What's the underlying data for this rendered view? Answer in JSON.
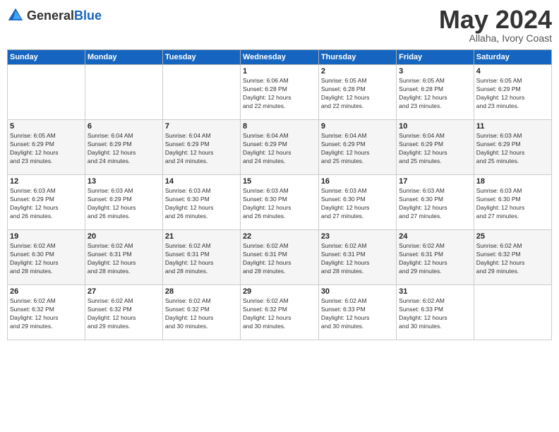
{
  "logo": {
    "general": "General",
    "blue": "Blue"
  },
  "header": {
    "month": "May 2024",
    "location": "Allaha, Ivory Coast"
  },
  "weekdays": [
    "Sunday",
    "Monday",
    "Tuesday",
    "Wednesday",
    "Thursday",
    "Friday",
    "Saturday"
  ],
  "weeks": [
    [
      {
        "day": "",
        "info": ""
      },
      {
        "day": "",
        "info": ""
      },
      {
        "day": "",
        "info": ""
      },
      {
        "day": "1",
        "info": "Sunrise: 6:06 AM\nSunset: 6:28 PM\nDaylight: 12 hours\nand 22 minutes."
      },
      {
        "day": "2",
        "info": "Sunrise: 6:05 AM\nSunset: 6:28 PM\nDaylight: 12 hours\nand 22 minutes."
      },
      {
        "day": "3",
        "info": "Sunrise: 6:05 AM\nSunset: 6:28 PM\nDaylight: 12 hours\nand 23 minutes."
      },
      {
        "day": "4",
        "info": "Sunrise: 6:05 AM\nSunset: 6:29 PM\nDaylight: 12 hours\nand 23 minutes."
      }
    ],
    [
      {
        "day": "5",
        "info": "Sunrise: 6:05 AM\nSunset: 6:29 PM\nDaylight: 12 hours\nand 23 minutes."
      },
      {
        "day": "6",
        "info": "Sunrise: 6:04 AM\nSunset: 6:29 PM\nDaylight: 12 hours\nand 24 minutes."
      },
      {
        "day": "7",
        "info": "Sunrise: 6:04 AM\nSunset: 6:29 PM\nDaylight: 12 hours\nand 24 minutes."
      },
      {
        "day": "8",
        "info": "Sunrise: 6:04 AM\nSunset: 6:29 PM\nDaylight: 12 hours\nand 24 minutes."
      },
      {
        "day": "9",
        "info": "Sunrise: 6:04 AM\nSunset: 6:29 PM\nDaylight: 12 hours\nand 25 minutes."
      },
      {
        "day": "10",
        "info": "Sunrise: 6:04 AM\nSunset: 6:29 PM\nDaylight: 12 hours\nand 25 minutes."
      },
      {
        "day": "11",
        "info": "Sunrise: 6:03 AM\nSunset: 6:29 PM\nDaylight: 12 hours\nand 25 minutes."
      }
    ],
    [
      {
        "day": "12",
        "info": "Sunrise: 6:03 AM\nSunset: 6:29 PM\nDaylight: 12 hours\nand 26 minutes."
      },
      {
        "day": "13",
        "info": "Sunrise: 6:03 AM\nSunset: 6:29 PM\nDaylight: 12 hours\nand 26 minutes."
      },
      {
        "day": "14",
        "info": "Sunrise: 6:03 AM\nSunset: 6:30 PM\nDaylight: 12 hours\nand 26 minutes."
      },
      {
        "day": "15",
        "info": "Sunrise: 6:03 AM\nSunset: 6:30 PM\nDaylight: 12 hours\nand 26 minutes."
      },
      {
        "day": "16",
        "info": "Sunrise: 6:03 AM\nSunset: 6:30 PM\nDaylight: 12 hours\nand 27 minutes."
      },
      {
        "day": "17",
        "info": "Sunrise: 6:03 AM\nSunset: 6:30 PM\nDaylight: 12 hours\nand 27 minutes."
      },
      {
        "day": "18",
        "info": "Sunrise: 6:03 AM\nSunset: 6:30 PM\nDaylight: 12 hours\nand 27 minutes."
      }
    ],
    [
      {
        "day": "19",
        "info": "Sunrise: 6:02 AM\nSunset: 6:30 PM\nDaylight: 12 hours\nand 28 minutes."
      },
      {
        "day": "20",
        "info": "Sunrise: 6:02 AM\nSunset: 6:31 PM\nDaylight: 12 hours\nand 28 minutes."
      },
      {
        "day": "21",
        "info": "Sunrise: 6:02 AM\nSunset: 6:31 PM\nDaylight: 12 hours\nand 28 minutes."
      },
      {
        "day": "22",
        "info": "Sunrise: 6:02 AM\nSunset: 6:31 PM\nDaylight: 12 hours\nand 28 minutes."
      },
      {
        "day": "23",
        "info": "Sunrise: 6:02 AM\nSunset: 6:31 PM\nDaylight: 12 hours\nand 28 minutes."
      },
      {
        "day": "24",
        "info": "Sunrise: 6:02 AM\nSunset: 6:31 PM\nDaylight: 12 hours\nand 29 minutes."
      },
      {
        "day": "25",
        "info": "Sunrise: 6:02 AM\nSunset: 6:32 PM\nDaylight: 12 hours\nand 29 minutes."
      }
    ],
    [
      {
        "day": "26",
        "info": "Sunrise: 6:02 AM\nSunset: 6:32 PM\nDaylight: 12 hours\nand 29 minutes."
      },
      {
        "day": "27",
        "info": "Sunrise: 6:02 AM\nSunset: 6:32 PM\nDaylight: 12 hours\nand 29 minutes."
      },
      {
        "day": "28",
        "info": "Sunrise: 6:02 AM\nSunset: 6:32 PM\nDaylight: 12 hours\nand 30 minutes."
      },
      {
        "day": "29",
        "info": "Sunrise: 6:02 AM\nSunset: 6:32 PM\nDaylight: 12 hours\nand 30 minutes."
      },
      {
        "day": "30",
        "info": "Sunrise: 6:02 AM\nSunset: 6:33 PM\nDaylight: 12 hours\nand 30 minutes."
      },
      {
        "day": "31",
        "info": "Sunrise: 6:02 AM\nSunset: 6:33 PM\nDaylight: 12 hours\nand 30 minutes."
      },
      {
        "day": "",
        "info": ""
      }
    ]
  ]
}
